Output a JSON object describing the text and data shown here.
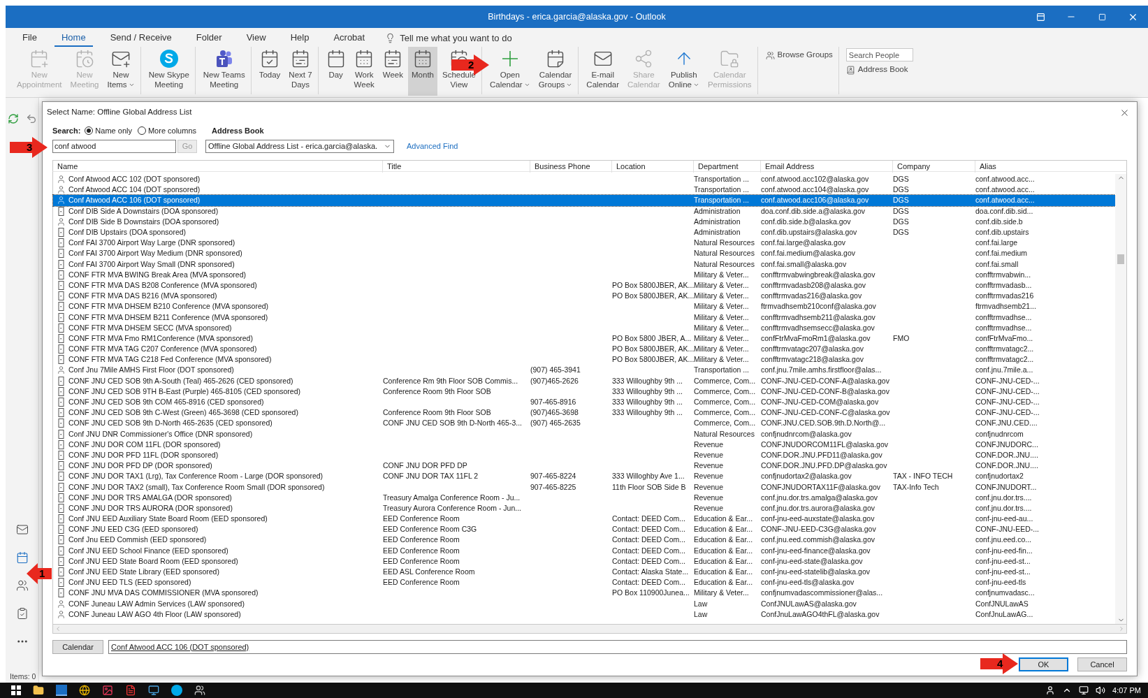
{
  "window": {
    "title": "Birthdays - erica.garcia@alaska.gov  -  Outlook"
  },
  "menu_tabs": [
    {
      "label": "File",
      "selected": false
    },
    {
      "label": "Home",
      "selected": true
    },
    {
      "label": "Send / Receive",
      "selected": false
    },
    {
      "label": "Folder",
      "selected": false
    },
    {
      "label": "View",
      "selected": false
    },
    {
      "label": "Help",
      "selected": false
    },
    {
      "label": "Acrobat",
      "selected": false
    }
  ],
  "tell_me": {
    "placeholder": "Tell me what you want to do"
  },
  "ribbon": {
    "groups": [
      {
        "buttons": [
          {
            "lines": [
              "New",
              "Appointment"
            ],
            "disabled": true,
            "selected": false,
            "dropdown": false
          },
          {
            "lines": [
              "New",
              "Meeting"
            ],
            "disabled": true,
            "selected": false,
            "dropdown": false
          },
          {
            "lines": [
              "New",
              "Items"
            ],
            "disabled": false,
            "selected": false,
            "dropdown": true
          }
        ]
      },
      {
        "buttons": [
          {
            "lines": [
              "New Skype",
              "Meeting"
            ],
            "disabled": false,
            "selected": false,
            "dropdown": false
          }
        ]
      },
      {
        "buttons": [
          {
            "lines": [
              "New Teams",
              "Meeting"
            ],
            "disabled": false,
            "selected": false,
            "dropdown": false
          }
        ]
      },
      {
        "buttons": [
          {
            "lines": [
              "Today"
            ],
            "disabled": false,
            "selected": false,
            "dropdown": false
          },
          {
            "lines": [
              "Next 7",
              "Days"
            ],
            "disabled": false,
            "selected": false,
            "dropdown": false
          }
        ]
      },
      {
        "buttons": [
          {
            "lines": [
              "Day"
            ],
            "disabled": false,
            "selected": false,
            "dropdown": false
          },
          {
            "lines": [
              "Work",
              "Week"
            ],
            "disabled": false,
            "selected": false,
            "dropdown": false
          },
          {
            "lines": [
              "Week"
            ],
            "disabled": false,
            "selected": false,
            "dropdown": false
          },
          {
            "lines": [
              "Month"
            ],
            "disabled": false,
            "selected": true,
            "dropdown": false
          },
          {
            "lines": [
              "Schedule",
              "View"
            ],
            "disabled": false,
            "selected": false,
            "dropdown": false
          }
        ]
      },
      {
        "buttons": [
          {
            "lines": [
              "Open",
              "Calendar"
            ],
            "disabled": false,
            "selected": false,
            "dropdown": true
          },
          {
            "lines": [
              "Calendar",
              "Groups"
            ],
            "disabled": false,
            "selected": false,
            "dropdown": true
          }
        ]
      },
      {
        "buttons": [
          {
            "lines": [
              "E-mail",
              "Calendar"
            ],
            "disabled": false,
            "selected": false,
            "dropdown": false
          },
          {
            "lines": [
              "Share",
              "Calendar"
            ],
            "disabled": true,
            "selected": false,
            "dropdown": false
          },
          {
            "lines": [
              "Publish",
              "Online"
            ],
            "disabled": false,
            "selected": false,
            "dropdown": true
          },
          {
            "lines": [
              "Calendar",
              "Permissions"
            ],
            "disabled": true,
            "selected": false,
            "dropdown": false
          }
        ]
      }
    ],
    "browse_groups": "Browse Groups",
    "search_people": {
      "placeholder": "Search People"
    },
    "address_book": "Address Book"
  },
  "status_bar": {
    "items": "Items: 0"
  },
  "dialog": {
    "title": "Select Name: Offline Global Address List",
    "search_label": "Search:",
    "search_modes": [
      {
        "label": "Name only",
        "selected": true
      },
      {
        "label": "More columns",
        "selected": false
      }
    ],
    "address_book_label": "Address Book",
    "search_field": {
      "value": "conf atwood"
    },
    "go_button": {
      "label": "Go",
      "disabled": true
    },
    "address_book_select": {
      "value": "Offline Global Address List - erica.garcia@alaska."
    },
    "advanced_find": "Advanced Find",
    "columns": [
      "Name",
      "Title",
      "Business Phone",
      "Location",
      "Department",
      "Email Address",
      "Company",
      "Alias"
    ],
    "rows": [
      {
        "kind": "person",
        "selected": false,
        "name": "Conf Atwood ACC 102 (DOT sponsored)",
        "department": "Transportation ...",
        "email": "conf.atwood.acc102@alaska.gov",
        "company": "DGS",
        "alias": "conf.atwood.acc..."
      },
      {
        "kind": "person",
        "selected": false,
        "name": "Conf Atwood ACC 104 (DOT sponsored)",
        "department": "Transportation ...",
        "email": "conf.atwood.acc104@alaska.gov",
        "company": "DGS",
        "alias": "conf.atwood.acc..."
      },
      {
        "kind": "person",
        "selected": true,
        "name": "Conf Atwood ACC 106 (DOT sponsored)",
        "department": "Transportation ...",
        "email": "conf.atwood.acc106@alaska.gov",
        "company": "DGS",
        "alias": "conf.atwood.acc..."
      },
      {
        "kind": "room",
        "selected": false,
        "name": "Conf DIB Side A Downstairs (DOA sponsored)",
        "department": "Administration",
        "email": "doa.conf.dib.side.a@alaska.gov",
        "company": "DGS",
        "alias": "doa.conf.dib.sid..."
      },
      {
        "kind": "person",
        "selected": false,
        "name": "Conf DIB Side B Downstairs (DOA sponsored)",
        "department": "Administration",
        "email": "conf.dib.side.b@alaska.gov",
        "company": "DGS",
        "alias": "conf.dib.side.b"
      },
      {
        "kind": "room",
        "selected": false,
        "name": "Conf DIB Upstairs (DOA sponsored)",
        "department": "Administration",
        "email": "conf.dib.upstairs@alaska.gov",
        "company": "DGS",
        "alias": "conf.dib.upstairs"
      },
      {
        "kind": "room",
        "selected": false,
        "name": "Conf FAI 3700 Airport Way Large (DNR sponsored)",
        "department": "Natural Resources",
        "email": "conf.fai.large@alaska.gov",
        "alias": "conf.fai.large"
      },
      {
        "kind": "room",
        "selected": false,
        "name": "Conf FAI 3700 Airport Way Medium (DNR sponsored)",
        "department": "Natural Resources",
        "email": "conf.fai.medium@alaska.gov",
        "alias": "conf.fai.medium"
      },
      {
        "kind": "room",
        "selected": false,
        "name": "Conf FAI 3700 Airport Way Small (DNR sponsored)",
        "department": "Natural Resources",
        "email": "conf.fai.small@alaska.gov",
        "alias": "conf.fai.small"
      },
      {
        "kind": "room",
        "selected": false,
        "name": "CONF FTR MVA BWING Break Area (MVA sponsored)",
        "department": "Military & Veter...",
        "email": "confftrmvabwingbreak@alaska.gov",
        "alias": "confftrmvabwin..."
      },
      {
        "kind": "room",
        "selected": false,
        "name": "CONF FTR MVA DAS B208 Conference (MVA sponsored)",
        "location": "PO Box 5800JBER, AK...",
        "department": "Military & Veter...",
        "email": "confftrmvadasb208@alaska.gov",
        "alias": "confftrmvadasb..."
      },
      {
        "kind": "room",
        "selected": false,
        "name": "CONF FTR MVA DAS B216 (MVA sponsored)",
        "location": "PO Box 5800JBER, AK...",
        "department": "Military & Veter...",
        "email": "confftrmvadas216@alaska.gov",
        "alias": "confftrmvadas216"
      },
      {
        "kind": "room",
        "selected": false,
        "name": "CONF FTR MVA DHSEM B210 Conference (MVA sponsored)",
        "department": "Military & Veter...",
        "email": "ftrmvadhsemb210conf@alaska.gov",
        "alias": "ftrmvadhsemb21..."
      },
      {
        "kind": "room",
        "selected": false,
        "name": "CONF FTR MVA DHSEM B211 Conference (MVA sponsored)",
        "department": "Military & Veter...",
        "email": "confftrmvadhsemb211@alaska.gov",
        "alias": "confftrmvadhse..."
      },
      {
        "kind": "room",
        "selected": false,
        "name": "CONF FTR MVA DHSEM SECC (MVA sponsored)",
        "department": "Military & Veter...",
        "email": "confftrmvadhsemsecc@alaska.gov",
        "alias": "confftrmvadhse..."
      },
      {
        "kind": "room",
        "selected": false,
        "name": "CONF FTR MVA Fmo RM1Conference (MVA sponsored)",
        "location": "PO Box 5800 JBER, A...",
        "department": "Military & Veter...",
        "email": "confFtrMvaFmoRm1@alaska.gov",
        "company": "FMO",
        "alias": "confFtrMvaFmo..."
      },
      {
        "kind": "room",
        "selected": false,
        "name": "CONF FTR MVA TAG C207 Conference (MVA sponsored)",
        "location": "PO Box 5800JBER, AK...",
        "department": "Military & Veter...",
        "email": "confftrmvatagc207@alaska.gov",
        "alias": "confftrmvatagc2..."
      },
      {
        "kind": "room",
        "selected": false,
        "name": "CONF FTR MVA TAG C218 Fed Conference (MVA sponsored)",
        "location": "PO Box 5800JBER, AK...",
        "department": "Military & Veter...",
        "email": "confftrmvatagc218@alaska.gov",
        "alias": "confftrmvatagc2..."
      },
      {
        "kind": "person",
        "selected": false,
        "name": "Conf Jnu 7Mile AMHS First Floor (DOT sponsored)",
        "business_phone": "(907) 465-3941",
        "department": "Transportation ...",
        "email": "conf.jnu.7mile.amhs.firstfloor@alas...",
        "alias": "conf.jnu.7mile.a..."
      },
      {
        "kind": "room",
        "selected": false,
        "name": "CONF JNU CED SOB 9th A-South (Teal) 465-2626 (CED sponsored)",
        "title": "Conference Rm 9th Floor SOB  Commis...",
        "business_phone": "(907)465-2626",
        "location": "333 Willoughby 9th ...",
        "department": "Commerce, Com...",
        "email": "CONF-JNU-CED-CONF-A@alaska.gov",
        "alias": "CONF-JNU-CED-..."
      },
      {
        "kind": "room",
        "selected": false,
        "name": "CONF JNU CED SOB 9TH B-East (Purple) 465-8105 (CED sponsored)",
        "title": "Conference Room 9th Floor SOB",
        "location": "333 Willoughby 9th ...",
        "department": "Commerce, Com...",
        "email": "CONF-JNU-CED-CONF-B@alaska.gov",
        "alias": "CONF-JNU-CED-..."
      },
      {
        "kind": "room",
        "selected": false,
        "name": "CONF JNU CED SOB 9th COM 465-8916 (CED sponsored)",
        "business_phone": "907-465-8916",
        "location": "333 Willoughby 9th ...",
        "department": "Commerce, Com...",
        "email": "CONF-JNU-CED-COM@alaska.gov",
        "alias": "CONF-JNU-CED-..."
      },
      {
        "kind": "room",
        "selected": false,
        "name": "CONF JNU CED SOB 9th C-West (Green) 465-3698 (CED sponsored)",
        "title": "Conference Room 9th Floor SOB",
        "business_phone": "(907)465-3698",
        "location": "333 Willoughby 9th ...",
        "department": "Commerce, Com...",
        "email": "CONF-JNU-CED-CONF-C@alaska.gov",
        "alias": "CONF-JNU-CED-..."
      },
      {
        "kind": "room",
        "selected": false,
        "name": "CONF JNU CED SOB 9th D-North 465-2635 (CED sponsored)",
        "title": "CONF JNU CED SOB 9th D-North 465-3...",
        "business_phone": "(907) 465-2635",
        "department": "Commerce, Com...",
        "email": "CONF.JNU.CED.SOB.9th.D.North@...",
        "alias": "CONF.JNU.CED...."
      },
      {
        "kind": "room",
        "selected": false,
        "name": "Conf JNU DNR Commissioner's Office (DNR sponsored)",
        "department": "Natural Resources",
        "email": "confjnudnrcom@alaska.gov",
        "alias": "confjnudnrcom"
      },
      {
        "kind": "room",
        "selected": false,
        "name": "CONF JNU DOR COM 11FL (DOR sponsored)",
        "department": "Revenue",
        "email": "CONFJNUDORCOM11FL@alaska.gov",
        "alias": "CONFJNUDORC..."
      },
      {
        "kind": "room",
        "selected": false,
        "name": "CONF JNU DOR PFD 11FL (DOR sponsored)",
        "department": "Revenue",
        "email": "CONF.DOR.JNU.PFD11@alaska.gov",
        "alias": "CONF.DOR.JNU...."
      },
      {
        "kind": "room",
        "selected": false,
        "name": "CONF JNU DOR PFD DP (DOR sponsored)",
        "title": "CONF JNU DOR PFD DP",
        "department": "Revenue",
        "email": "CONF.DOR.JNU.PFD.DP@alaska.gov",
        "alias": "CONF.DOR.JNU...."
      },
      {
        "kind": "room",
        "selected": false,
        "name": "CONF JNU DOR TAX1 (Lrg), Tax Conference Room - Large (DOR sponsored)",
        "title": "CONF JNU DOR TAX 11FL 2",
        "business_phone": "907-465-8224",
        "location": "333 Willoghby Ave 1...",
        "department": "Revenue",
        "email": "confjnudortax2@alaska.gov",
        "company": "TAX - INFO TECH",
        "alias": "confjnudortax2"
      },
      {
        "kind": "room",
        "selected": false,
        "name": "CONF JNU DOR TAX2 (small), Tax Conference Room Small (DOR sponsored)",
        "business_phone": "907-465-8225",
        "location": "11th Floor SOB Side B",
        "department": "Revenue",
        "email": "CONFJNUDORTAX11F@alaska.gov",
        "company": "TAX-Info Tech",
        "alias": "CONFJNUDORT..."
      },
      {
        "kind": "room",
        "selected": false,
        "name": "CONF JNU DOR TRS AMALGA (DOR sponsored)",
        "title": "Treasury Amalga Conference Room - Ju...",
        "department": "Revenue",
        "email": "conf.jnu.dor.trs.amalga@alaska.gov",
        "alias": "conf.jnu.dor.trs...."
      },
      {
        "kind": "room",
        "selected": false,
        "name": "CONF JNU DOR TRS AURORA (DOR sponsored)",
        "title": "Treasury Aurora Conference Room - Jun...",
        "department": "Revenue",
        "email": "conf.jnu.dor.trs.aurora@alaska.gov",
        "alias": "conf.jnu.dor.trs...."
      },
      {
        "kind": "room",
        "selected": false,
        "name": "Conf JNU EED Auxiliary State Board Room (EED sponsored)",
        "title": "EED Conference Room",
        "location": "Contact: DEED Com...",
        "department": "Education & Ear...",
        "email": "conf-jnu-eed-auxstate@alaska.gov",
        "alias": "conf-jnu-eed-au..."
      },
      {
        "kind": "room",
        "selected": false,
        "name": "CONF JNU EED C3G (EED sponsored)",
        "title": "EED Conference Room C3G",
        "location": "Contact: DEED Com...",
        "department": "Education & Ear...",
        "email": "CONF-JNU-EED-C3G@alaska.gov",
        "alias": "CONF-JNU-EED-..."
      },
      {
        "kind": "room",
        "selected": false,
        "name": "Conf Jnu EED Commish (EED sponsored)",
        "title": "EED Conference Room",
        "location": "Contact: DEED Com...",
        "department": "Education & Ear...",
        "email": "conf.jnu.eed.commish@alaska.gov",
        "alias": "conf.jnu.eed.co..."
      },
      {
        "kind": "room",
        "selected": false,
        "name": "Conf JNU EED School Finance (EED sponsored)",
        "title": "EED Conference Room",
        "location": "Contact: DEED Com...",
        "department": "Education & Ear...",
        "email": "conf-jnu-eed-finance@alaska.gov",
        "alias": "conf-jnu-eed-fin..."
      },
      {
        "kind": "room",
        "selected": false,
        "name": "Conf JNU EED State Board Room (EED sponsored)",
        "title": "EED Conference Room",
        "location": "Contact: DEED Com...",
        "department": "Education & Ear...",
        "email": "conf-jnu-eed-state@alaska.gov",
        "alias": "conf-jnu-eed-st..."
      },
      {
        "kind": "room",
        "selected": false,
        "name": "Conf JNU EED State Library (EED sponsored)",
        "title": "EED ASL Conference Room",
        "location": "Contact: Alaska State...",
        "department": "Education & Ear...",
        "email": "conf-jnu-eed-statelib@alaska.gov",
        "alias": "conf-jnu-eed-st..."
      },
      {
        "kind": "room",
        "selected": false,
        "name": "Conf JNU EED TLS (EED sponsored)",
        "title": "EED Conference Room",
        "location": "Contact: DEED Com...",
        "department": "Education & Ear...",
        "email": "conf-jnu-eed-tls@alaska.gov",
        "alias": "conf-jnu-eed-tls"
      },
      {
        "kind": "room",
        "selected": false,
        "name": "CONF JNU MVA DAS COMMISSIONER (MVA sponsored)",
        "location": "PO Box 110900Junea...",
        "department": "Military & Veter...",
        "email": "confjnumvadascommissioner@alas...",
        "alias": "confjnumvadasc..."
      },
      {
        "kind": "person",
        "selected": false,
        "name": "CONF Juneau LAW Admin Services (LAW sponsored)",
        "department": "Law",
        "email": "ConfJNULawAS@alaska.gov",
        "alias": "ConfJNULawAS"
      },
      {
        "kind": "person",
        "selected": false,
        "name": "CONF Juneau LAW AGO 4th Floor (LAW sponsored)",
        "department": "Law",
        "email": "ConfJnuLawAGO4thFL@alaska.gov",
        "alias": "ConfJnuLawAG..."
      }
    ],
    "calendar_button": "Calendar",
    "recipients_field": {
      "value": "Conf Atwood ACC 106 (DOT sponsored)"
    },
    "buttons": [
      {
        "label": "OK",
        "default": true
      },
      {
        "label": "Cancel",
        "default": false
      }
    ]
  },
  "annotations": [
    {
      "number": "1",
      "kind": "leftward"
    },
    {
      "number": "2",
      "kind": "rightward"
    },
    {
      "number": "3",
      "kind": "rightward"
    },
    {
      "number": "4",
      "kind": "rightward"
    }
  ],
  "taskbar": {
    "clock": "4:07 PM"
  }
}
